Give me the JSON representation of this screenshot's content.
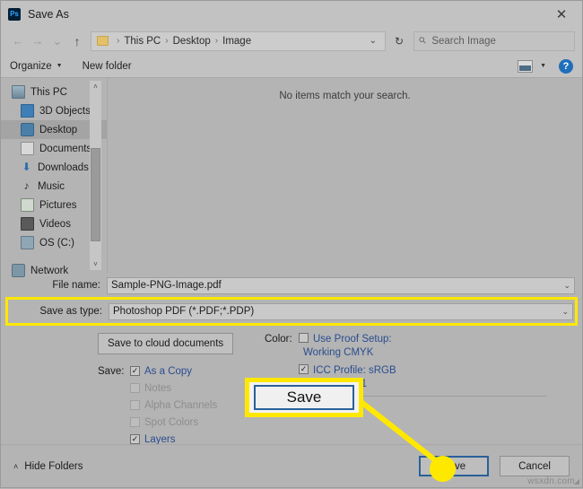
{
  "titlebar": {
    "app_icon": "photoshop-icon",
    "app_icon_text": "Ps",
    "title": "Save As",
    "close_label": "✕"
  },
  "addressbar": {
    "back_label": "←",
    "forward_label": "→",
    "recent_label": "⌄",
    "up_label": "↑",
    "breadcrumbs": [
      "This PC",
      "Desktop",
      "Image"
    ],
    "separator": "›",
    "dropdown_label": "⌄",
    "refresh_label": "↻",
    "search_placeholder": "Search Image",
    "search_value": ""
  },
  "toolbar": {
    "organize_label": "Organize",
    "organize_caret": "▼",
    "new_folder_label": "New folder",
    "view_caret": "▼",
    "help_label": "?"
  },
  "sidebar": {
    "items": [
      {
        "label": "This PC",
        "icon": "computer-icon",
        "selected": false
      },
      {
        "label": "3D Objects",
        "icon": "3d-objects-icon",
        "selected": false
      },
      {
        "label": "Desktop",
        "icon": "desktop-icon",
        "selected": true
      },
      {
        "label": "Documents",
        "icon": "documents-icon",
        "selected": false
      },
      {
        "label": "Downloads",
        "icon": "downloads-icon",
        "selected": false
      },
      {
        "label": "Music",
        "icon": "music-icon",
        "selected": false
      },
      {
        "label": "Pictures",
        "icon": "pictures-icon",
        "selected": false
      },
      {
        "label": "Videos",
        "icon": "videos-icon",
        "selected": false
      },
      {
        "label": "OS (C:)",
        "icon": "drive-icon",
        "selected": false
      },
      {
        "label": "Network",
        "icon": "network-icon",
        "selected": false
      }
    ],
    "scroll_up": "˄",
    "scroll_down": "˅"
  },
  "filelist": {
    "empty_message": "No items match your search."
  },
  "form": {
    "filename_label": "File name:",
    "filename_value": "Sample-PNG-Image.pdf",
    "filetype_label": "Save as type:",
    "filetype_value": "Photoshop PDF (*.PDF;*.PDP)",
    "chevron": "⌄"
  },
  "options": {
    "cloud_button_label": "Save to cloud documents",
    "save_prefix": "Save:",
    "save_items": [
      {
        "label": "As a Copy",
        "checked": true,
        "enabled": true
      },
      {
        "label": "Notes",
        "checked": false,
        "enabled": false
      },
      {
        "label": "Alpha Channels",
        "checked": false,
        "enabled": false
      },
      {
        "label": "Spot Colors",
        "checked": false,
        "enabled": false
      },
      {
        "label": "Layers",
        "checked": true,
        "enabled": true
      }
    ],
    "color_prefix": "Color:",
    "proof_label": "Use Proof Setup:",
    "proof_sub": "Working CMYK",
    "proof_checked": false,
    "icc_label": "ICC Profile:  sRGB",
    "icc_sub": "IEC61966-2.1",
    "icc_checked": true,
    "occluded_label": "il",
    "check_glyph": "✓"
  },
  "callout": {
    "label": "Save"
  },
  "footer": {
    "hide_folders_label": "Hide Folders",
    "hide_folders_caret": "˄",
    "save_label": "Save",
    "cancel_label": "Cancel",
    "watermark": "wsxdn.com",
    "grip": "◢"
  },
  "colors": {
    "highlight": "#ffe800",
    "accent_blue": "#2a6099",
    "link_blue": "#2a4d8f",
    "window_bg": "#b4b4b4",
    "chrome_bg": "#c2c2c2"
  }
}
